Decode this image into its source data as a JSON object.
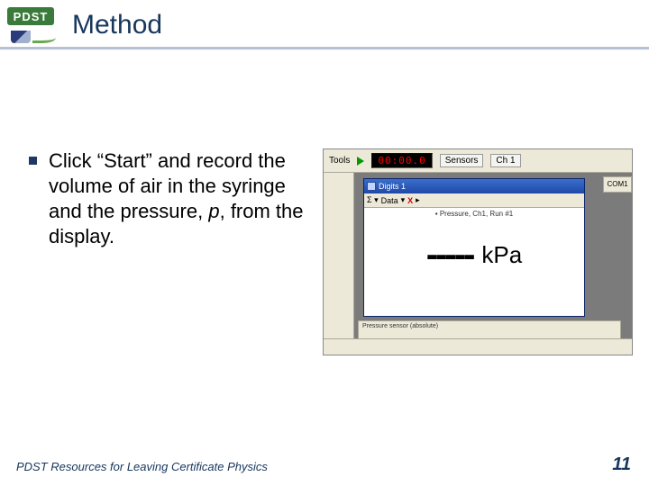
{
  "logo": {
    "text": "PDST"
  },
  "title": "Method",
  "bullet": {
    "pre": "Click “Start” and record the volume of air in the syringe and the pressure, ",
    "var": "p",
    "post": ", from the display."
  },
  "screenshot": {
    "toolbar": {
      "tools_label": "Tools",
      "timer": "00:00.0",
      "sensors_label": "Sensors",
      "toggle_label": "Ch 1"
    },
    "window": {
      "title": "Digits 1",
      "data_btn": "Data",
      "delete_btn": "X",
      "legend": "▪ Pressure, Ch1, Run #1",
      "dashes": "-----",
      "unit": "kPa"
    },
    "right_strip": "COM1",
    "bottom_strip": "Pressure sensor (absolute)"
  },
  "footer": "PDST Resources for Leaving Certificate Physics",
  "page_number": "11"
}
